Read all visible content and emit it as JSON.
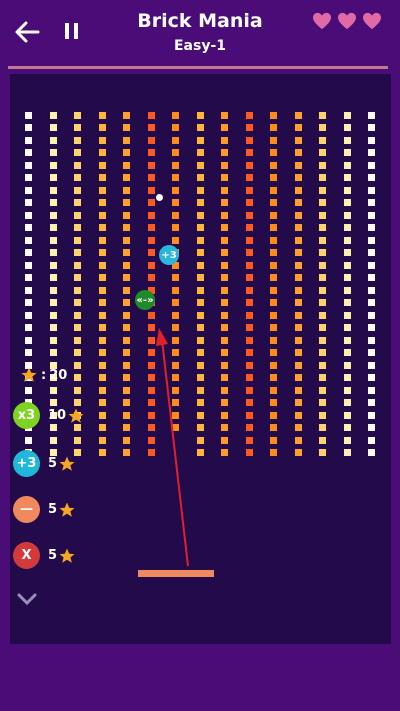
{
  "header": {
    "title": "Brick Mania",
    "level": "Easy-1"
  },
  "lives": 3,
  "colors": {
    "background": "#4a0d78",
    "playfield": "#230a4a",
    "paddle": "#f08a5e",
    "heart": "#e06aa6",
    "divider": "#c07a8b"
  },
  "stars": {
    "separator": ":",
    "value": "20"
  },
  "powerups_in_field": [
    {
      "icon": "plus3-icon",
      "label": "+3",
      "color": "#29b6d8"
    },
    {
      "icon": "shrink-icon",
      "label": "«-»",
      "color": "#1f8a2a"
    }
  ],
  "shop": [
    {
      "icon": "times3-icon",
      "label": "x3",
      "price": "10",
      "color": "#7ed321"
    },
    {
      "icon": "plus3-icon",
      "label": "+3",
      "price": "5",
      "color": "#1fb8d8"
    },
    {
      "icon": "minus-icon",
      "label": "—",
      "price": "5",
      "color": "#f08a5e"
    },
    {
      "icon": "close-x-icon",
      "label": "X",
      "price": "5",
      "color": "#d33b3b"
    }
  ],
  "brick_columns": [
    {
      "color": "#ffffff",
      "count": 14,
      "start_row": 0
    },
    {
      "color": "#fff0b0",
      "count": 14,
      "start_row": 0
    },
    {
      "color": "#ffd26e",
      "count": 14,
      "start_row": 0
    },
    {
      "color": "#ffb43c",
      "count": 14,
      "start_row": 0
    },
    {
      "color": "#ffa030",
      "count": 14,
      "start_row": 0
    },
    {
      "color": "#ff5a22",
      "count": 14,
      "start_row": 0
    },
    {
      "color": "#ff8a1e",
      "count": 13,
      "start_row": 0
    },
    {
      "color": "#ffb43c",
      "count": 14,
      "start_row": 0
    },
    {
      "color": "#ff9a2a",
      "count": 14,
      "start_row": 0
    },
    {
      "color": "#ff5a22",
      "count": 14,
      "start_row": 0
    },
    {
      "color": "#ff8a1e",
      "count": 14,
      "start_row": 0
    },
    {
      "color": "#ffa030",
      "count": 14,
      "start_row": 0
    },
    {
      "color": "#ffd26e",
      "count": 14,
      "start_row": 0
    },
    {
      "color": "#fff0b0",
      "count": 14,
      "start_row": 0
    },
    {
      "color": "#ffffff",
      "count": 14,
      "start_row": 0
    }
  ]
}
